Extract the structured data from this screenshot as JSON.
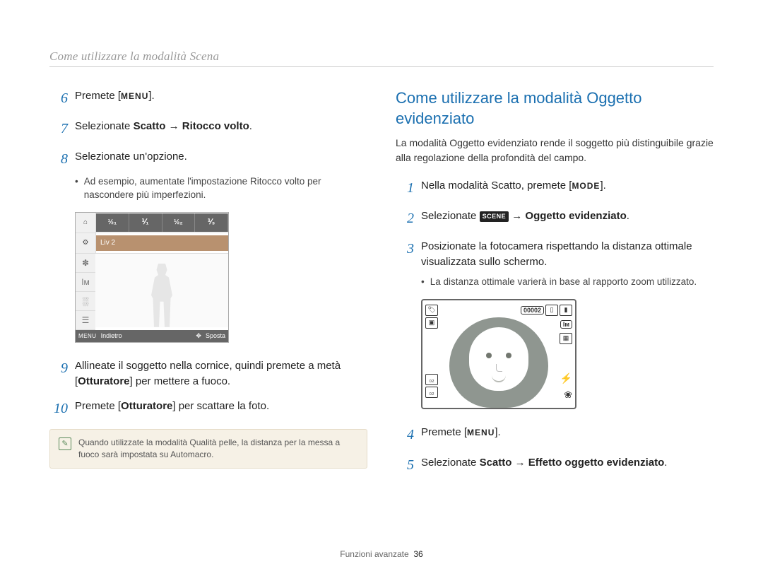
{
  "header": "Come utilizzare la modalità Scena",
  "left": {
    "step6": {
      "num": "6",
      "pre": "Premete [",
      "menu": "MENU",
      "post": "]."
    },
    "step7": {
      "num": "7",
      "pre": "Selezionate ",
      "bold1": "Scatto",
      "arrow": " → ",
      "bold2": "Ritocco volto",
      "post": "."
    },
    "step8": {
      "num": "8",
      "text": "Selezionate un'opzione."
    },
    "bullet8": "Ad esempio, aumentate l'impostazione Ritocco volto per nascondere più imperfezioni.",
    "screenshot": {
      "tabs": [
        "½₁",
        "⅟₁",
        "½₂",
        "⅟₃"
      ],
      "liv": "Liv 2",
      "side_icons": [
        "⌂",
        "⚙",
        "✽",
        "Iм",
        "░",
        "☰"
      ],
      "footer_menu_label": "MENU",
      "footer_back": "Indietro",
      "footer_nav_icon": "✥",
      "footer_move": "Sposta"
    },
    "step9": {
      "num": "9",
      "pre": "Allineate il soggetto nella cornice, quindi premete a metà [",
      "bold": "Otturatore",
      "post": "] per mettere a fuoco."
    },
    "step10": {
      "num": "10",
      "pre": "Premete [",
      "bold": "Otturatore",
      "post": "] per scattare la foto."
    },
    "note": "Quando utilizzate la modalità Qualità pelle, la distanza per la messa a fuoco sarà impostata su Automacro."
  },
  "right": {
    "title": "Come utilizzare la modalità Oggetto evidenziato",
    "desc": "La modalità Oggetto evidenziato rende il soggetto più distinguibile grazie alla regolazione della profondità del campo.",
    "step1": {
      "num": "1",
      "pre": "Nella modalità Scatto, premete [",
      "mode": "MODE",
      "post": "]."
    },
    "step2": {
      "num": "2",
      "pre": "Selezionate ",
      "scene": "SCENE",
      "arrow": " → ",
      "bold": "Oggetto evidenziato",
      "post": "."
    },
    "step3": {
      "num": "3",
      "text": "Posizionate la fotocamera rispettando la distanza ottimale visualizzata sullo schermo."
    },
    "bullet3": "La distanza ottimale varierà in base al rapporto zoom utilizzato.",
    "screenshot": {
      "counter": "00002",
      "im": "Iм",
      "left1": "🏷",
      "left2": "▣",
      "chip1": "₀₂",
      "chip2": "₀₂",
      "flash": "⚡",
      "macro": "❀"
    },
    "step4": {
      "num": "4",
      "pre": "Premete [",
      "menu": "MENU",
      "post": "]."
    },
    "step5": {
      "num": "5",
      "pre": "Selezionate ",
      "bold1": "Scatto",
      "arrow": " → ",
      "bold2": "Effetto oggetto evidenziato",
      "post": "."
    }
  },
  "footer": {
    "label": "Funzioni avanzate",
    "page": "36"
  }
}
